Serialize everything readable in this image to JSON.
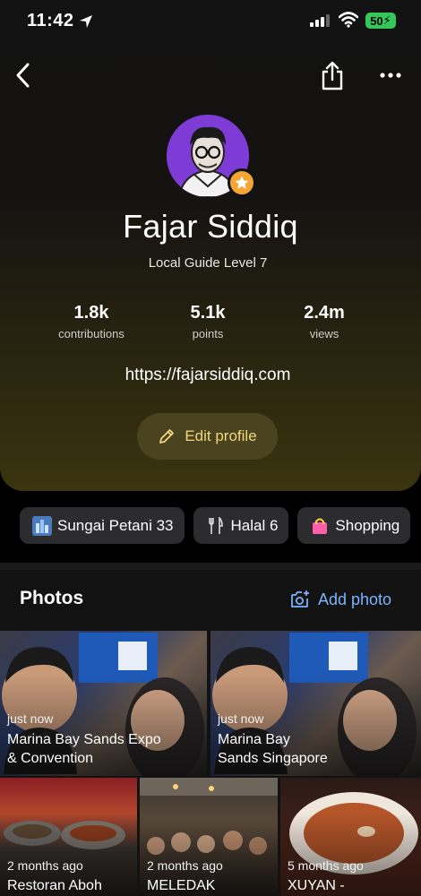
{
  "status_bar": {
    "time": "11:42",
    "battery": "50"
  },
  "profile": {
    "name": "Fajar Siddiq",
    "level": "Local Guide Level 7",
    "website": "https://fajarsiddiq.com",
    "edit_label": "Edit profile"
  },
  "stats": [
    {
      "value": "1.8k",
      "label": "contributions"
    },
    {
      "value": "5.1k",
      "label": "points"
    },
    {
      "value": "2.4m",
      "label": "views"
    }
  ],
  "chips": [
    {
      "label": "Sungai Petani 33",
      "icon": "city-icon"
    },
    {
      "label": "Halal 6",
      "icon": "fork-knife-icon"
    },
    {
      "label": "Shopping",
      "icon": "shopping-bag-icon"
    }
  ],
  "photos": {
    "title": "Photos",
    "add_label": "Add photo",
    "items": [
      {
        "when": "just now",
        "place_line1": "Marina Bay Sands Expo",
        "place_line2": "& Convention"
      },
      {
        "when": "just now",
        "place_line1": "Marina Bay",
        "place_line2": "Sands Singapore"
      },
      {
        "when": "2 months ago",
        "place_line1": "Restoran Aboh",
        "place_line2": ""
      },
      {
        "when": "2 months ago",
        "place_line1": "MELEDAK",
        "place_line2": ""
      },
      {
        "when": "5 months ago",
        "place_line1": "XUYAN -",
        "place_line2": ""
      }
    ]
  },
  "colors": {
    "accent_gold": "#f1d67a",
    "link_blue": "#79b4ff",
    "avatar_bg": "#7e3bd6",
    "badge": "#f4a534"
  }
}
